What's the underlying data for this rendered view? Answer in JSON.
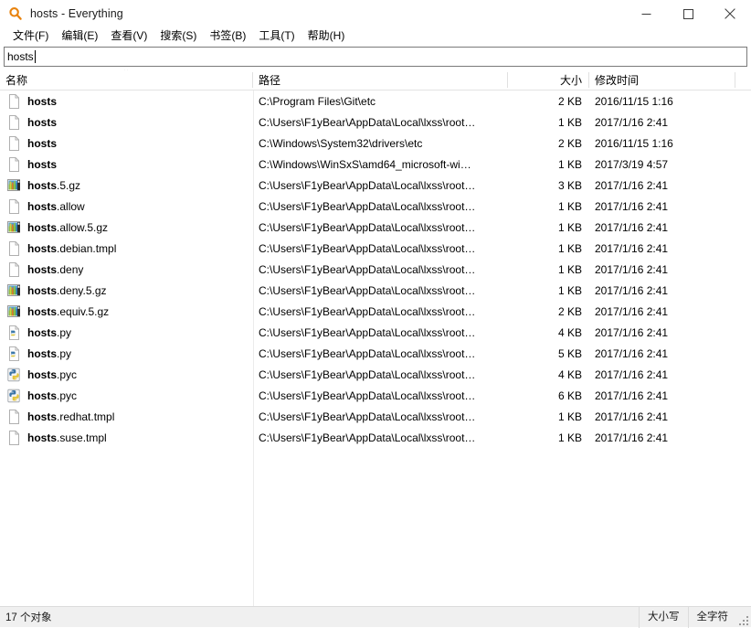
{
  "window": {
    "title": "hosts - Everything",
    "app_icon": "magnifier-icon",
    "controls": {
      "minimize": "minimize-icon",
      "maximize": "maximize-icon",
      "close": "close-icon"
    }
  },
  "menubar": {
    "items": [
      {
        "label": "文件(F)"
      },
      {
        "label": "编辑(E)"
      },
      {
        "label": "查看(V)"
      },
      {
        "label": "搜索(S)"
      },
      {
        "label": "书签(B)"
      },
      {
        "label": "工具(T)"
      },
      {
        "label": "帮助(H)"
      }
    ]
  },
  "search": {
    "value": "hosts",
    "placeholder": ""
  },
  "columns": {
    "name": "名称",
    "path": "路径",
    "size": "大小",
    "date": "修改时间",
    "sort_column": "名称",
    "sort_direction": "ascending",
    "sort_indicator": "⌃"
  },
  "results": [
    {
      "match": "hosts",
      "rest": "",
      "icon": "generic-file-icon",
      "path": "C:\\Program Files\\Git\\etc",
      "size": "2 KB",
      "date": "2016/11/15 1:16"
    },
    {
      "match": "hosts",
      "rest": "",
      "icon": "generic-file-icon",
      "path": "C:\\Users\\F1yBear\\AppData\\Local\\lxss\\root…",
      "size": "1 KB",
      "date": "2017/1/16 2:41"
    },
    {
      "match": "hosts",
      "rest": "",
      "icon": "generic-file-icon",
      "path": "C:\\Windows\\System32\\drivers\\etc",
      "size": "2 KB",
      "date": "2016/11/15 1:16"
    },
    {
      "match": "hosts",
      "rest": "",
      "icon": "generic-file-icon",
      "path": "C:\\Windows\\WinSxS\\amd64_microsoft-wi…",
      "size": "1 KB",
      "date": "2017/3/19 4:57"
    },
    {
      "match": "hosts",
      "rest": ".5.gz",
      "icon": "archive-image-icon",
      "path": "C:\\Users\\F1yBear\\AppData\\Local\\lxss\\root…",
      "size": "3 KB",
      "date": "2017/1/16 2:41"
    },
    {
      "match": "hosts",
      "rest": ".allow",
      "icon": "generic-file-icon",
      "path": "C:\\Users\\F1yBear\\AppData\\Local\\lxss\\root…",
      "size": "1 KB",
      "date": "2017/1/16 2:41"
    },
    {
      "match": "hosts",
      "rest": ".allow.5.gz",
      "icon": "archive-image-icon",
      "path": "C:\\Users\\F1yBear\\AppData\\Local\\lxss\\root…",
      "size": "1 KB",
      "date": "2017/1/16 2:41"
    },
    {
      "match": "hosts",
      "rest": ".debian.tmpl",
      "icon": "generic-file-icon",
      "path": "C:\\Users\\F1yBear\\AppData\\Local\\lxss\\root…",
      "size": "1 KB",
      "date": "2017/1/16 2:41"
    },
    {
      "match": "hosts",
      "rest": ".deny",
      "icon": "generic-file-icon",
      "path": "C:\\Users\\F1yBear\\AppData\\Local\\lxss\\root…",
      "size": "1 KB",
      "date": "2017/1/16 2:41"
    },
    {
      "match": "hosts",
      "rest": ".deny.5.gz",
      "icon": "archive-image-icon",
      "path": "C:\\Users\\F1yBear\\AppData\\Local\\lxss\\root…",
      "size": "1 KB",
      "date": "2017/1/16 2:41"
    },
    {
      "match": "hosts",
      "rest": ".equiv.5.gz",
      "icon": "archive-image-icon",
      "path": "C:\\Users\\F1yBear\\AppData\\Local\\lxss\\root…",
      "size": "2 KB",
      "date": "2017/1/16 2:41"
    },
    {
      "match": "hosts",
      "rest": ".py",
      "icon": "python-source-icon",
      "path": "C:\\Users\\F1yBear\\AppData\\Local\\lxss\\root…",
      "size": "4 KB",
      "date": "2017/1/16 2:41"
    },
    {
      "match": "hosts",
      "rest": ".py",
      "icon": "python-source-icon",
      "path": "C:\\Users\\F1yBear\\AppData\\Local\\lxss\\root…",
      "size": "5 KB",
      "date": "2017/1/16 2:41"
    },
    {
      "match": "hosts",
      "rest": ".pyc",
      "icon": "python-compiled-icon",
      "path": "C:\\Users\\F1yBear\\AppData\\Local\\lxss\\root…",
      "size": "4 KB",
      "date": "2017/1/16 2:41"
    },
    {
      "match": "hosts",
      "rest": ".pyc",
      "icon": "python-compiled-icon",
      "path": "C:\\Users\\F1yBear\\AppData\\Local\\lxss\\root…",
      "size": "6 KB",
      "date": "2017/1/16 2:41"
    },
    {
      "match": "hosts",
      "rest": ".redhat.tmpl",
      "icon": "generic-file-icon",
      "path": "C:\\Users\\F1yBear\\AppData\\Local\\lxss\\root…",
      "size": "1 KB",
      "date": "2017/1/16 2:41"
    },
    {
      "match": "hosts",
      "rest": ".suse.tmpl",
      "icon": "generic-file-icon",
      "path": "C:\\Users\\F1yBear\\AppData\\Local\\lxss\\root…",
      "size": "1 KB",
      "date": "2017/1/16 2:41"
    }
  ],
  "statusbar": {
    "count_text": "17 个对象",
    "match_case": "大小写",
    "match_whole_word": "全字符"
  },
  "colors": {
    "accent": "#e8820c",
    "window_bg": "#ffffff",
    "statusbar_bg": "#f0f0f0",
    "divider": "#e2e2e2",
    "text": "#000000"
  }
}
